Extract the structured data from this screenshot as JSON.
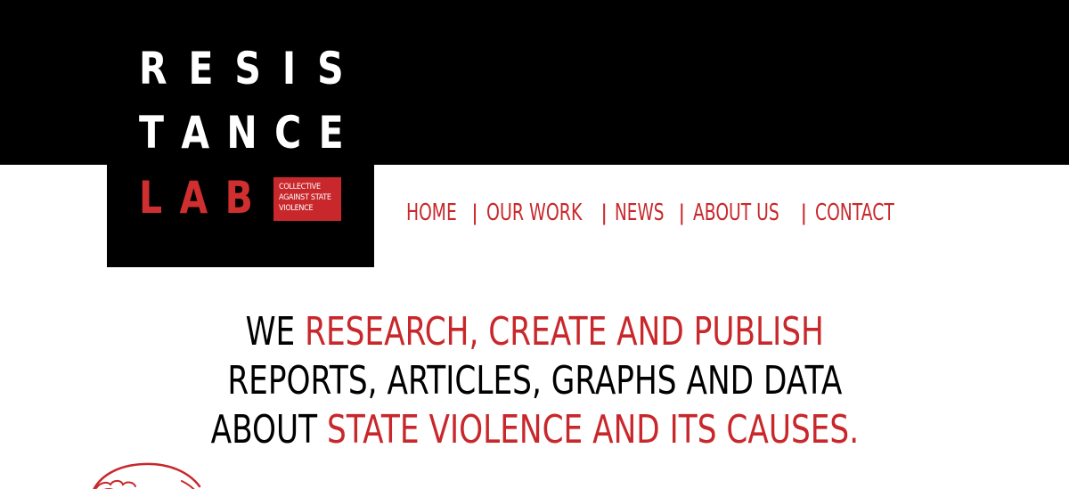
{
  "logo": {
    "line1": [
      "R",
      "E",
      "S",
      "I",
      "S"
    ],
    "line2": [
      "T",
      "A",
      "N",
      "C",
      "E"
    ],
    "line3": [
      "L",
      "A",
      "B"
    ],
    "tagline": [
      "COLLECTIVE",
      "AGAINST STATE",
      "VIOLENCE"
    ]
  },
  "nav": {
    "items": [
      "HOME",
      "OUR WORK",
      "NEWS",
      "ABOUT US",
      "CONTACT"
    ],
    "separator": "|"
  },
  "hero": {
    "line1_black": "WE ",
    "line1_red": "RESEARCH, CREATE AND PUBLISH",
    "line2_black": "REPORTS, ARTICLES, GRAPHS AND DATA",
    "line3_black": "ABOUT ",
    "line3_red": "STATE VIOLENCE AND ITS CAUSES."
  },
  "colors": {
    "brand_red": "#c8282b",
    "black": "#000000",
    "white": "#ffffff"
  }
}
